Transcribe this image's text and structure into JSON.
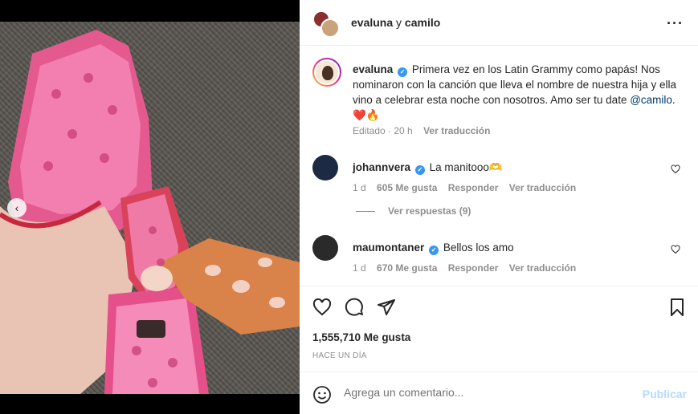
{
  "header": {
    "username": "evaluna",
    "joiner": "y",
    "collaborator": "camilo",
    "more_icon": "more-horizontal-icon"
  },
  "caption": {
    "username": "evaluna",
    "text": "Primera vez en los Latin Grammy como papás! Nos nominaron con la canción que lleva el nombre de nuestra hija y ella vino a celebrar esta noche con nosotros. Amo ser tu date",
    "mention": "@camilo.",
    "emojis": "❤️🔥",
    "edited": "Editado · 20 h",
    "translate": "Ver traducción"
  },
  "comments": [
    {
      "username": "johannvera",
      "text": "La manitooo🫶",
      "time": "1 d",
      "likes": "605 Me gusta",
      "reply": "Responder",
      "translate": "Ver traducción",
      "avatar_color": "#1d2a44"
    },
    {
      "username": "maumontaner",
      "text": "Bellos los amo",
      "time": "1 d",
      "likes": "670 Me gusta",
      "reply": "Responder",
      "translate": "Ver traducción",
      "avatar_color": "#2a2a2a"
    }
  ],
  "view_replies": "Ver respuestas (9)",
  "actions": {
    "icons": [
      "heart-icon",
      "comment-icon",
      "share-icon",
      "bookmark-icon"
    ]
  },
  "likes_count": "1,555,710 Me gusta",
  "timestamp": "HACE UN DÍA",
  "add_comment": {
    "placeholder": "Agrega un comentario...",
    "post_label": "Publicar"
  },
  "colors": {
    "verified": "#3897f0",
    "post_button": "#b3dbff",
    "secondary_text": "#8e8e8e"
  }
}
